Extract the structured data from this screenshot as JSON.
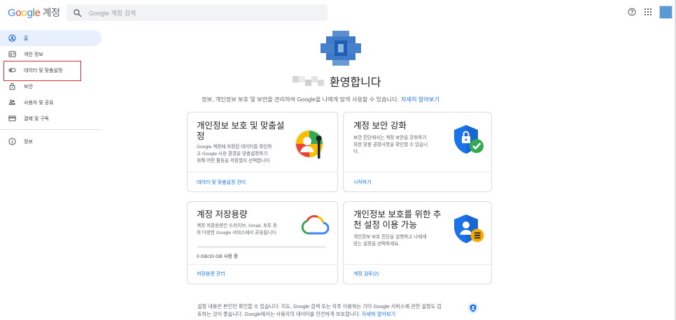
{
  "header": {
    "logo": {
      "google": "Google",
      "account": "계정"
    },
    "search_placeholder": "Google 계정 검색"
  },
  "sidebar": {
    "items": [
      {
        "label": "홈",
        "icon": "home-icon"
      },
      {
        "label": "개인 정보",
        "icon": "id-card-icon"
      },
      {
        "label": "데이터 및 맞춤설정",
        "icon": "toggle-icon"
      },
      {
        "label": "보안",
        "icon": "lock-icon"
      },
      {
        "label": "사용자 및 공유",
        "icon": "people-icon"
      },
      {
        "label": "결제 및 구독",
        "icon": "credit-card-icon"
      },
      {
        "label": "정보",
        "icon": "info-icon"
      }
    ]
  },
  "main": {
    "welcome": "환영합니다",
    "intro": "정보, 개인정보 보호 및 보안을 관리하여 Google을 나에게 맞게 사용할 수 있습니다.",
    "intro_link": "자세히 알아보기",
    "cards": [
      {
        "title_l1": "개인정보 보호 및 맞춤설",
        "title_l2": "정",
        "desc_l1": "Google 계정에 저장된 데이터를 확인하",
        "desc_l2": "고 Google 사용 환경을 맞춤설정하기",
        "desc_l3": "위해 어떤 활동을 저장할지 선택합니다.",
        "action": "데이터 및 맞춤설정 관리"
      },
      {
        "title_l1": "계정 보안 강화",
        "desc_l1": "보안 진단에서는 계정 보안을 강화하기",
        "desc_l2": "위한 맞춤 권장사항을 확인할 수 있습니",
        "desc_l3": "다.",
        "action": "시작하기"
      },
      {
        "title_l1": "계정 저장용량",
        "desc_l1": "계정 저장용량은 드라이브, Gmail, 포토 등",
        "desc_l2": "의 다양한 Google 서비스에서 공유됩니다.",
        "storage": "0 GB/15 GB 사용 중",
        "storage_used_fraction": 0,
        "action": "저장용량 관리"
      },
      {
        "title_l1": "개인정보 보호를 위한 추",
        "title_l2": "천 설정 이용 가능",
        "desc_l1": "개인정보 보호 진단을 실행하고 나에게",
        "desc_l2": "맞는 설정을 선택하세요.",
        "action": "계정 검토(2)"
      }
    ]
  },
  "footer": {
    "line1": "설정 내용은 본인만 확인할 수 있습니다. 지도, Google 검색 또는 자주 이용하는 기타 Google 서비스에 관한 설정도 검",
    "line2": "토하는 것이 좋습니다. Google에서는 사용자의 데이터를 안전하게 보호합니다.",
    "link": "자세히 알아보기"
  },
  "colors": {
    "accent": "#1a73e8",
    "active_bg": "#e8f0fe",
    "highlight_box": "#d32f2f",
    "avatar_blue": "#5b9bd5"
  }
}
